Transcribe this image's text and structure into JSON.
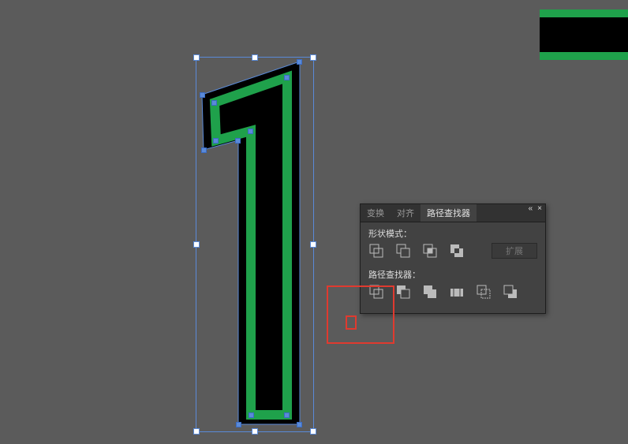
{
  "colors": {
    "accent_green": "#1fa14b",
    "accent_red": "#e03a2f",
    "selection_blue": "#5a8ad8"
  },
  "panel": {
    "menu_hint": "«",
    "close_hint": "×",
    "tabs": {
      "transform": "变换",
      "align": "对齐",
      "pathfinder": "路径查找器",
      "active": "pathfinder"
    },
    "section_shape_modes": "形状模式：",
    "section_pathfinders": "路径查找器：",
    "expand_label": "扩展",
    "shape_mode_icons": [
      "unite-icon",
      "minus-front-icon",
      "intersect-icon",
      "exclude-icon"
    ],
    "pathfinder_icons": [
      "divide-icon",
      "trim-icon",
      "merge-icon",
      "crop-icon",
      "outline-icon",
      "minus-back-icon"
    ]
  },
  "artwork": {
    "name": "numeral-1",
    "stroke": "none",
    "fill_outer": "#000000",
    "fill_inner": "#1fa14b"
  }
}
